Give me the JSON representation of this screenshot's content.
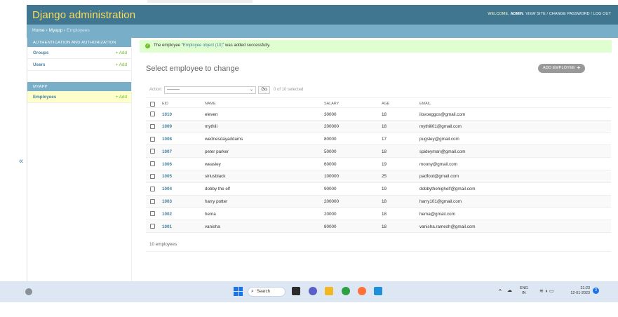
{
  "header": {
    "brand": "Django administration",
    "welcome": "WELCOME,",
    "user": "ADMIN",
    "view_site": "VIEW SITE",
    "change_password": "CHANGE PASSWORD",
    "logout": "LOG OUT",
    "sep": "/"
  },
  "breadcrumbs": {
    "home": "Home",
    "app": "Myapp",
    "current": "Employees",
    "sep": "›"
  },
  "sidebar": {
    "toggle": "«",
    "auth_title": "AUTHENTICATION AND AUTHORIZATION",
    "auth_items": [
      {
        "label": "Groups",
        "add": "+ Add"
      },
      {
        "label": "Users",
        "add": "+ Add"
      }
    ],
    "app_title": "MYAPP",
    "app_items": [
      {
        "label": "Employees",
        "add": "+ Add"
      }
    ]
  },
  "message": {
    "prefix": "The employee “",
    "object": "Employee object (10)",
    "suffix": "” was added successfully."
  },
  "page_title": "Select employee to change",
  "add_button": "ADD EMPLOYEE",
  "actions": {
    "label": "Action:",
    "selected_option": "---------",
    "go": "Go",
    "count": "0 of 10 selected"
  },
  "table": {
    "headers": {
      "eid": "EID",
      "name": "NAME",
      "salary": "SALARY",
      "age": "AGE",
      "email": "EMAIL"
    },
    "rows": [
      {
        "eid": "1010",
        "name": "eleven",
        "salary": "30000",
        "age": "18",
        "email": "ilovoeggos@gmail.com"
      },
      {
        "eid": "1009",
        "name": "mythili",
        "salary": "200000",
        "age": "18",
        "email": "mythili01@gmail.com"
      },
      {
        "eid": "1008",
        "name": "wednesdayaddams",
        "salary": "80000",
        "age": "17",
        "email": "pugsley@gmail.com"
      },
      {
        "eid": "1007",
        "name": "peter parker",
        "salary": "50000",
        "age": "18",
        "email": "spideyman@gmail.com"
      },
      {
        "eid": "1006",
        "name": "weasley",
        "salary": "60000",
        "age": "19",
        "email": "moony@gmail.com"
      },
      {
        "eid": "1005",
        "name": "siriusblack",
        "salary": "100000",
        "age": "25",
        "email": "padfoot@gmail.com"
      },
      {
        "eid": "1004",
        "name": "dobby the elf",
        "salary": "90000",
        "age": "19",
        "email": "dobbythehighelf@gmail.com"
      },
      {
        "eid": "1003",
        "name": "harry potter",
        "salary": "200000",
        "age": "18",
        "email": "harry101@gmail.com"
      },
      {
        "eid": "1002",
        "name": "hema",
        "salary": "20000",
        "age": "18",
        "email": "hema@gmail.com"
      },
      {
        "eid": "1001",
        "name": "vanisha",
        "salary": "80000",
        "age": "18",
        "email": "vanisha.ramesh@gmail.com"
      }
    ],
    "total": "10 employees"
  },
  "taskbar": {
    "search": "Search",
    "lang_top": "ENG",
    "lang_bottom": "IN",
    "time": "21:23",
    "date": "12-01-2023",
    "notifications": "3"
  },
  "colors": {
    "header": "#417690",
    "brand": "#f5dd5d",
    "module": "#79aec8",
    "link": "#447e9b",
    "add": "#70bf2b",
    "success": "#dfffd0"
  }
}
